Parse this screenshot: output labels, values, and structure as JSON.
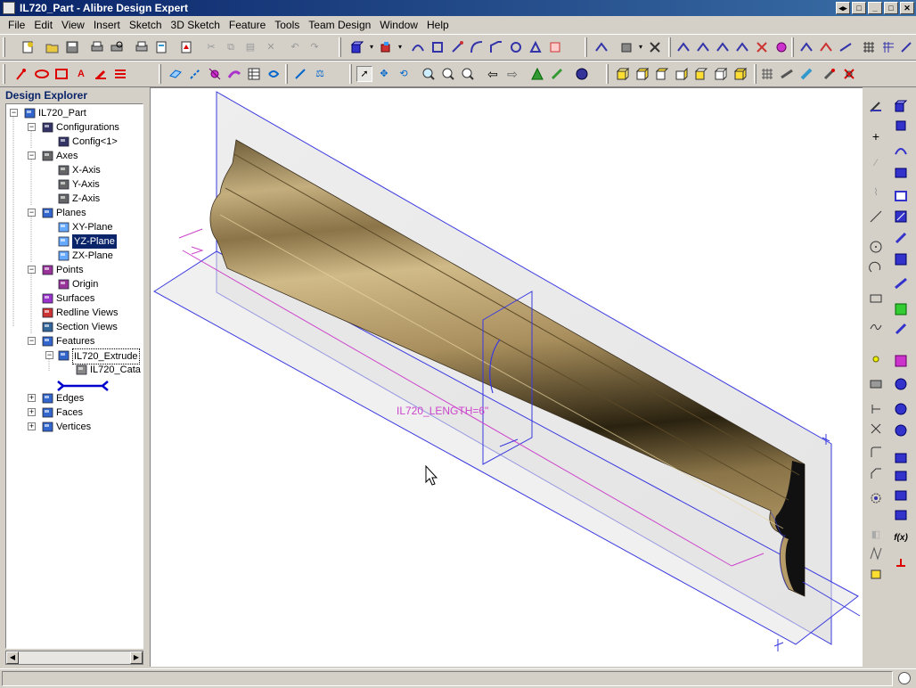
{
  "window": {
    "title": "IL720_Part - Alibre Design Expert",
    "buttons": [
      "restore-icon",
      "help-icon",
      "minimize-icon",
      "maximize-icon",
      "close-icon"
    ]
  },
  "menu": [
    "File",
    "Edit",
    "View",
    "Insert",
    "Sketch",
    "3D Sketch",
    "Feature",
    "Tools",
    "Team Design",
    "Window",
    "Help"
  ],
  "toolbar_icons": {
    "row1": [
      "new-icon",
      "open-icon",
      "save-icon",
      "print-icon",
      "print-preview-icon",
      "pdf-icon",
      "cut-icon",
      "copy-icon",
      "paste-icon",
      "delete-icon",
      "undo-icon",
      "redo-icon",
      "extrude-icon",
      "revolve-icon",
      "sweep-icon",
      "loft-icon",
      "shell-icon",
      "fillet-icon",
      "chamfer-icon",
      "hole-icon",
      "draft-icon",
      "mirror-icon",
      "pattern-icon",
      "thicken-icon",
      "split-icon",
      "boolean-icon",
      "sheetmetal-icon",
      "ref-geometry-icon"
    ],
    "row2": [
      "sketch-line-icon",
      "sketch-circle-icon",
      "sketch-rect-icon",
      "sketch-text-icon",
      "sketch-erase-icon",
      "sketch-list-icon",
      "plane-icon",
      "axis-icon",
      "point-icon",
      "surface-icon",
      "table-icon",
      "toggle-icon",
      "measure-icon",
      "balance-icon",
      "select-arrow-icon",
      "pan-icon",
      "rotate-icon",
      "zoom-in-icon",
      "zoom-window-icon",
      "zoom-all-icon",
      "prev-view-icon",
      "next-view-icon",
      "view-orient-icon",
      "view-normal-icon",
      "render-icon",
      "cube-front-icon",
      "cube-back-icon",
      "cube-top-icon",
      "cube-bottom-icon",
      "cube-left-icon",
      "cube-right-icon",
      "cube-iso-icon",
      "wireframe-icon",
      "hidden-line-icon",
      "shaded-icon",
      "section-icon",
      "clip-icon"
    ]
  },
  "explorer": {
    "heading": "Design Explorer",
    "tree": [
      {
        "label": "IL720_Part",
        "icon": "part-icon",
        "expander": "−"
      },
      {
        "label": "Configurations",
        "icon": "configurations-icon",
        "expander": "−"
      },
      {
        "label": "Config<1>",
        "icon": "config-icon",
        "expander": ""
      },
      {
        "label": "Axes",
        "icon": "axes-icon",
        "expander": "−"
      },
      {
        "label": "X-Axis",
        "icon": "axis-icon",
        "expander": ""
      },
      {
        "label": "Y-Axis",
        "icon": "axis-icon",
        "expander": ""
      },
      {
        "label": "Z-Axis",
        "icon": "axis-icon",
        "expander": ""
      },
      {
        "label": "Planes",
        "icon": "planes-icon",
        "expander": "−"
      },
      {
        "label": "XY-Plane",
        "icon": "plane-icon",
        "expander": ""
      },
      {
        "label": "YZ-Plane",
        "icon": "plane-icon",
        "expander": "",
        "selected": true
      },
      {
        "label": "ZX-Plane",
        "icon": "plane-icon",
        "expander": ""
      },
      {
        "label": "Points",
        "icon": "points-icon",
        "expander": "−"
      },
      {
        "label": "Origin",
        "icon": "origin-icon",
        "expander": ""
      },
      {
        "label": "Surfaces",
        "icon": "surfaces-icon",
        "expander": ""
      },
      {
        "label": "Redline Views",
        "icon": "redline-icon",
        "expander": ""
      },
      {
        "label": "Section Views",
        "icon": "section-views-icon",
        "expander": ""
      },
      {
        "label": "Features",
        "icon": "features-icon",
        "expander": "−"
      },
      {
        "label": "IL720_Extrude",
        "icon": "extrude-feature-icon",
        "expander": "−",
        "focused": true
      },
      {
        "label": "IL720_Cata",
        "icon": "sketch-icon",
        "expander": ""
      },
      {
        "label": "",
        "icon": "end-of-part-marker-icon",
        "expander": ""
      },
      {
        "label": "Edges",
        "icon": "edges-icon",
        "expander": "+"
      },
      {
        "label": "Faces",
        "icon": "faces-icon",
        "expander": "+"
      },
      {
        "label": "Vertices",
        "icon": "vertices-icon",
        "expander": "+"
      }
    ]
  },
  "viewport": {
    "dimension_label": "IL720_LENGTH=6\"",
    "dimension_color": "#cc44cc",
    "plane_color": "#3a3ae0",
    "model_color": "#a08c5e"
  },
  "right_toolbar_icons": [
    "sketch-mode-icon",
    "point-icon",
    "line-icon",
    "circle-icon",
    "arc-icon",
    "rectangle-icon",
    "polygon-icon",
    "spline-icon",
    "dimension-icon",
    "constraint-icon",
    "trim-icon",
    "extend-icon",
    "fillet-sketch-icon",
    "chamfer-sketch-icon",
    "offset-icon",
    "mirror-sketch-icon",
    "fx-equations-icon",
    "reference-icon"
  ],
  "status": {
    "text": ""
  }
}
